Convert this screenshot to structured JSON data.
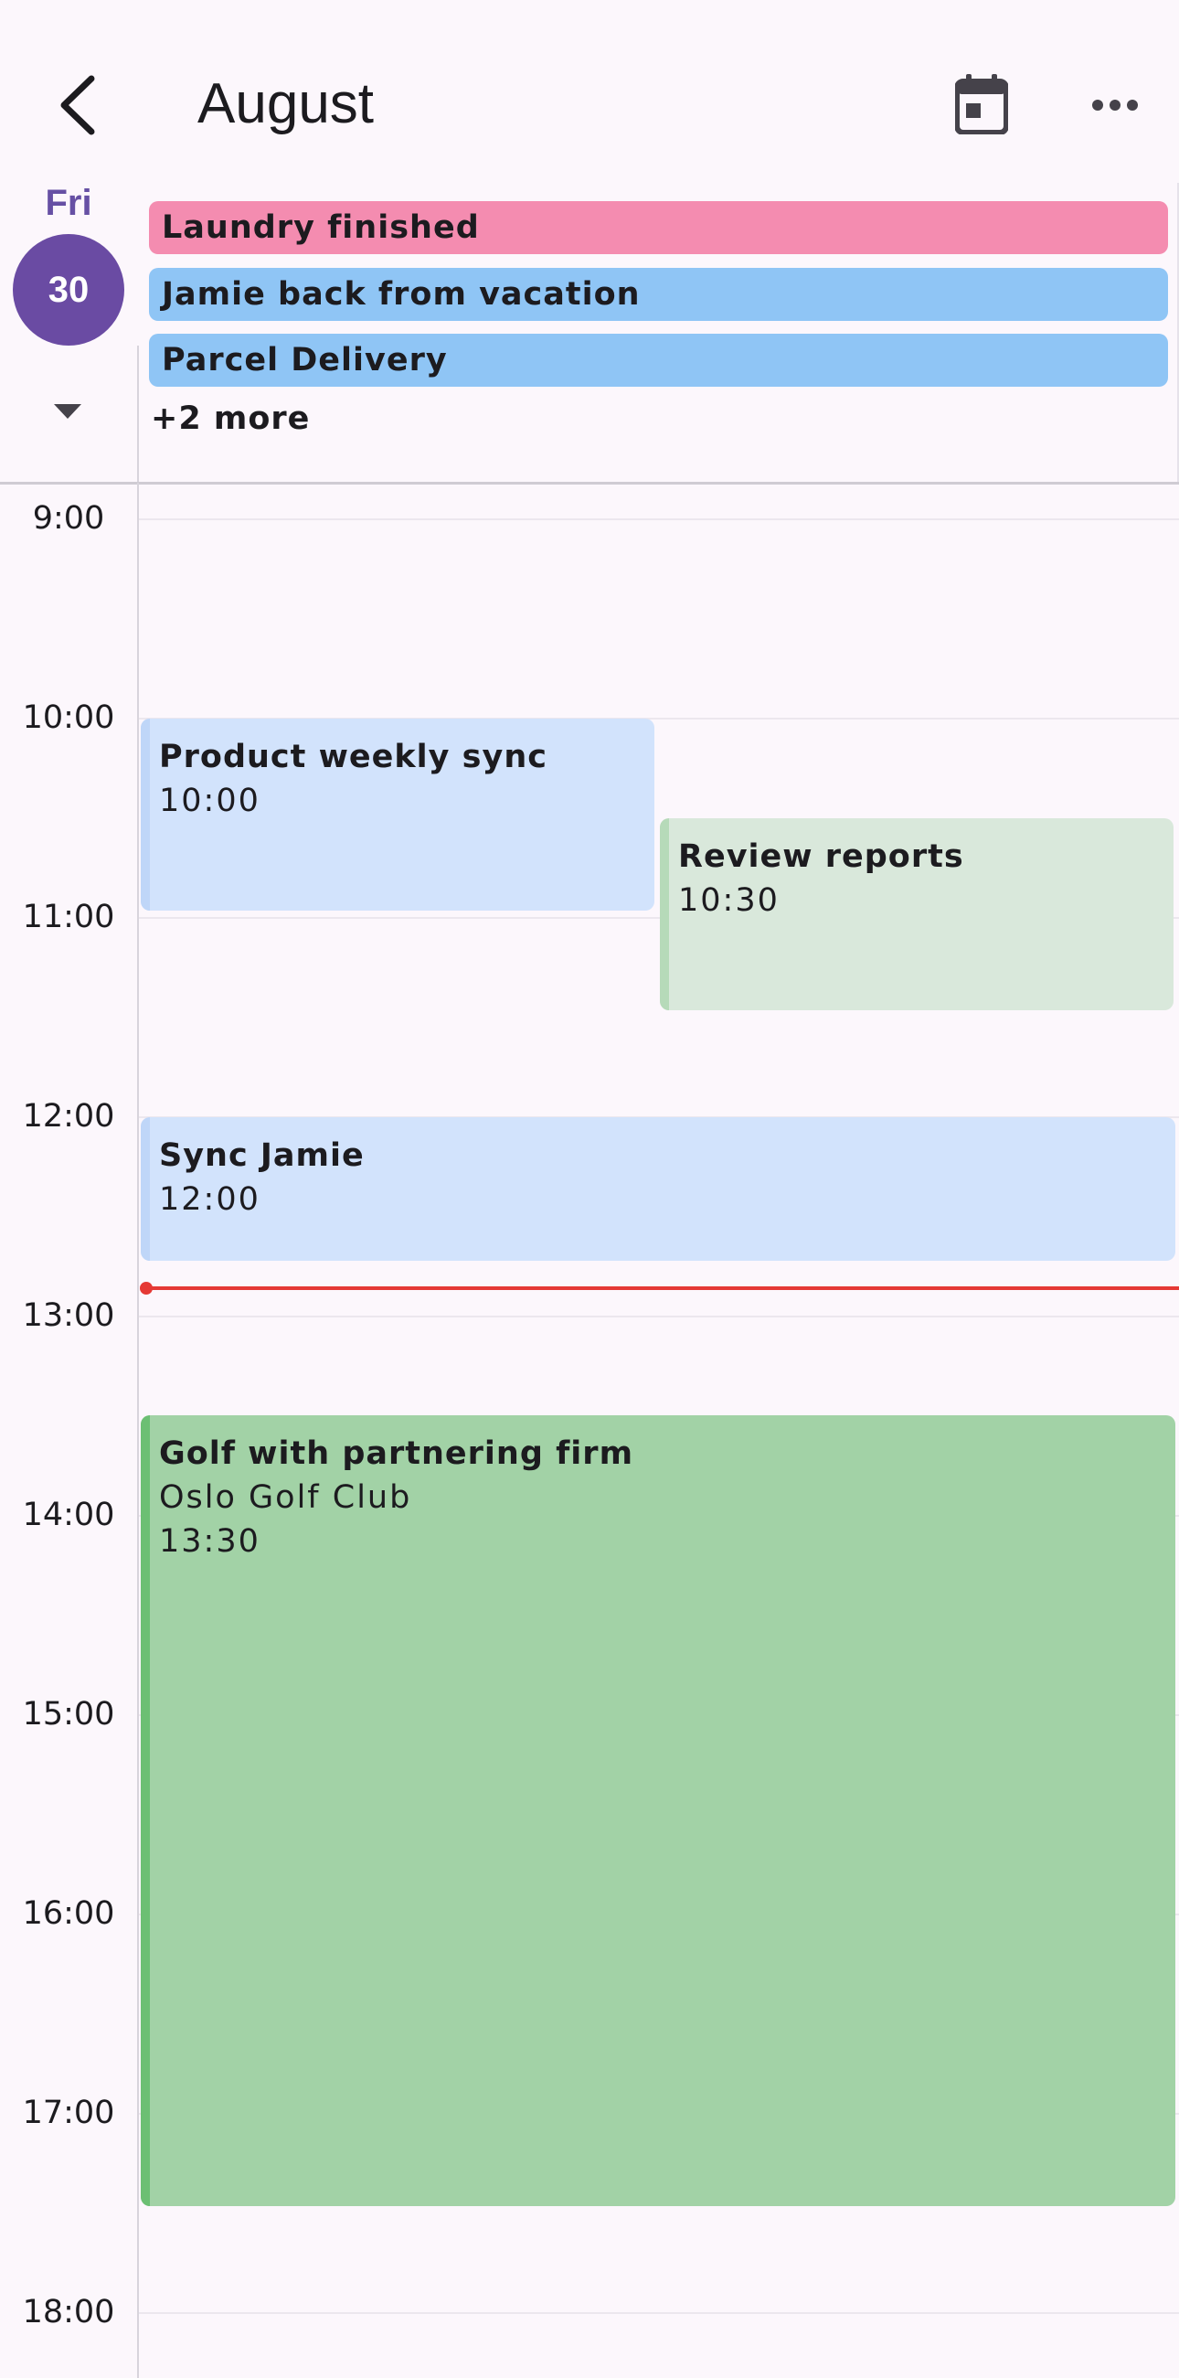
{
  "header": {
    "title": "August",
    "back_icon": "chevron-left-icon",
    "calendar_icon": "calendar-today-icon",
    "more_icon": "more-horizontal-icon"
  },
  "day": {
    "weekday": "Fri",
    "date": "30",
    "expand_icon": "caret-down-icon"
  },
  "all_day_events": [
    {
      "title": "Laundry finished",
      "color": "#F48CB0"
    },
    {
      "title": "Jamie back from vacation",
      "color": "#8FC5F5"
    },
    {
      "title": "Parcel Delivery",
      "color": "#8FC5F5"
    }
  ],
  "more_label": "+2 more",
  "hours": [
    "9:00",
    "10:00",
    "11:00",
    "12:00",
    "13:00",
    "14:00",
    "15:00",
    "16:00",
    "17:00",
    "18:00"
  ],
  "events": [
    {
      "title": "Product weekly sync",
      "time": "10:00",
      "color": "#D2E3FC"
    },
    {
      "title": "Review reports",
      "time": "10:30",
      "color": "#D9E8DB"
    },
    {
      "title": "Sync Jamie",
      "time": "12:00",
      "color": "#D2E3FC"
    },
    {
      "title": "Golf with partnering firm",
      "location": "Oslo Golf Club",
      "time": "13:30",
      "color": "#A2D2A6"
    }
  ],
  "now_indicator_color": "#E53935"
}
